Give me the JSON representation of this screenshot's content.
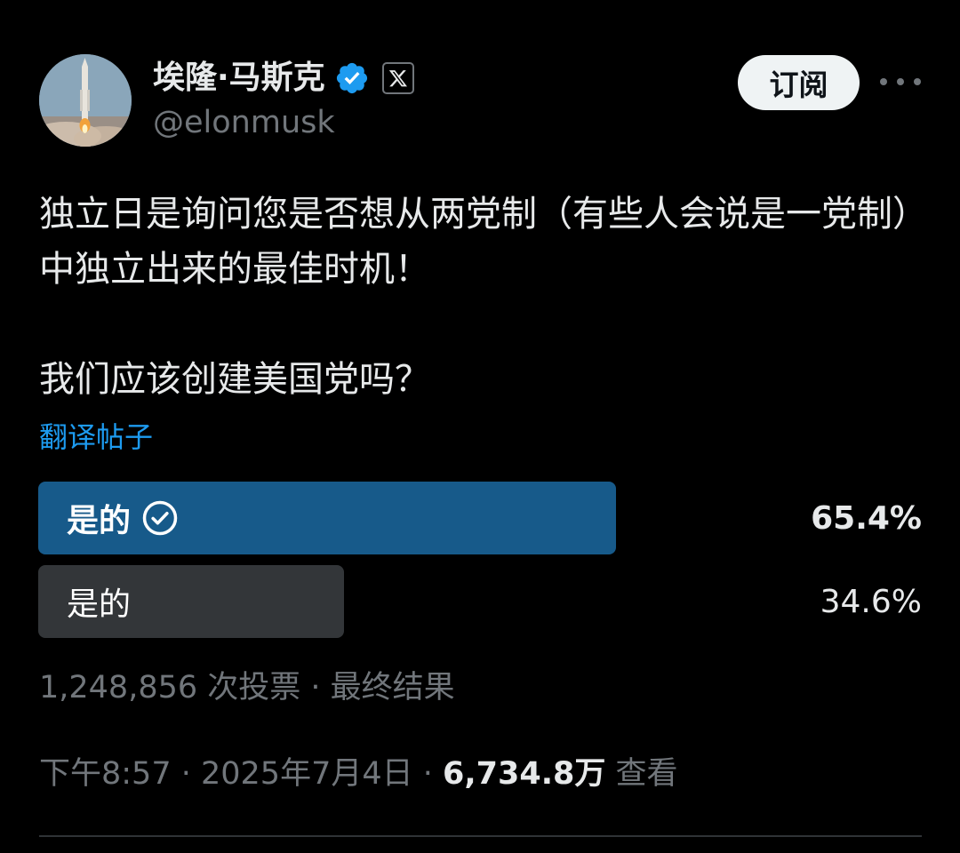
{
  "author": {
    "display_name": "埃隆·马斯克",
    "handle": "@elonmusk",
    "verified": true,
    "affiliate_badge_icon": "x-logo-icon",
    "avatar_icon": "rocket-launch-avatar"
  },
  "header": {
    "subscribe_label": "订阅",
    "more_icon": "more-horizontal-icon"
  },
  "tweet": {
    "paragraph_1": "独立日是询问您是否想从两党制（有些人会说是一党制）中独立出来的最佳时机！",
    "paragraph_2": "我们应该创建美国党吗？",
    "translate_label": "翻译帖子"
  },
  "poll": {
    "options": [
      {
        "label": "是的",
        "percent_text": "65.4%",
        "percent": 65.4,
        "selected": true
      },
      {
        "label": "是的",
        "percent_text": "34.6%",
        "percent": 34.6,
        "selected": false
      }
    ],
    "summary": "1,248,856 次投票 · 最终结果"
  },
  "meta": {
    "time": "下午8:57",
    "separator": " · ",
    "date": "2025年7月4日",
    "views_count": "6,734.8万",
    "views_label": "查看"
  },
  "colors": {
    "background": "#000000",
    "text_primary": "#e7e9ea",
    "text_secondary": "#71767b",
    "link": "#1d9bf0",
    "verified_badge": "#1d9bf0",
    "poll_winner": "#175a8a",
    "poll_other": "#333639",
    "subscribe_bg": "#eff3f4"
  }
}
